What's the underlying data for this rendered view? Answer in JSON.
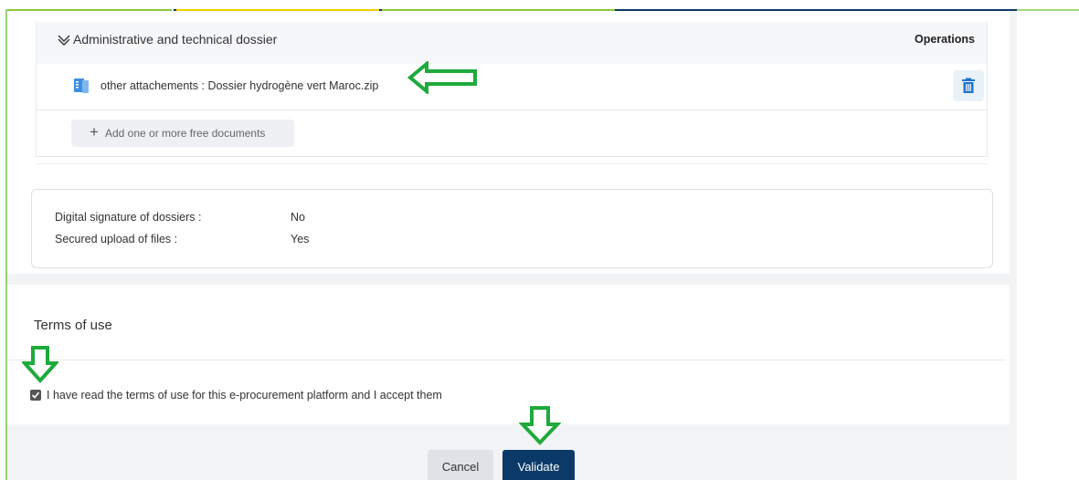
{
  "colors": {
    "accent": "#0b3a69",
    "annotation_arrow": "#1faa3c",
    "trash": "#1f73c9"
  },
  "dossier": {
    "title": "Administrative and technical dossier",
    "operations_label": "Operations",
    "attachment": {
      "label": "other attachements : ",
      "filename": "Dossier hydrogène vert Maroc.zip"
    },
    "add_label": "Add one or more free documents"
  },
  "signature": {
    "rows": [
      {
        "label": "Digital signature of dossiers :",
        "value": "No"
      },
      {
        "label": "Secured upload of files :",
        "value": "Yes"
      }
    ]
  },
  "terms": {
    "title": "Terms of use",
    "checkbox_label": "I have read the terms of use for this e-procurement platform and I accept them",
    "checked": true
  },
  "actions": {
    "cancel_label": "Cancel",
    "validate_label": "Validate"
  },
  "annotations": [
    "left-arrow",
    "down-arrow",
    "down-arrow"
  ]
}
